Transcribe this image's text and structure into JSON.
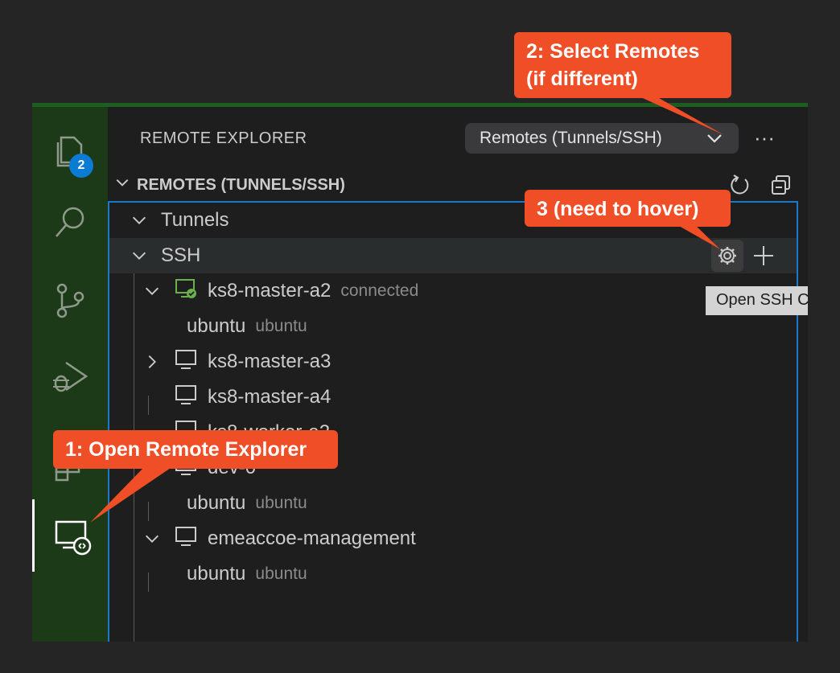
{
  "activity_bar": {
    "explorer_badge": "2"
  },
  "panel": {
    "title": "REMOTE EXPLORER",
    "dropdown_label": "Remotes (Tunnels/SSH)",
    "more_label": "···",
    "section_title": "REMOTES (TUNNELS/SSH)"
  },
  "tree": {
    "tunnels_label": "Tunnels",
    "ssh_label": "SSH",
    "hosts": [
      {
        "name": "ks8-master-a2",
        "status": "connected"
      },
      {
        "child_name": "ubuntu",
        "child_desc": "ubuntu"
      },
      {
        "name": "ks8-master-a3"
      },
      {
        "name": "ks8-master-a4"
      },
      {
        "name": "ks8-worker-a2"
      },
      {
        "name": "dev-0"
      },
      {
        "child_name": "ubuntu",
        "child_desc": "ubuntu"
      },
      {
        "name": "emeaccoe-management"
      },
      {
        "child_name": "ubuntu",
        "child_desc": "ubuntu"
      }
    ]
  },
  "tooltip": "Open SSH Config File",
  "callouts": {
    "one": "1: Open Remote Explorer",
    "two_line1": "2: Select Remotes",
    "two_line2": "(if different)",
    "three": "3 (need to hover)"
  },
  "colors": {
    "callout": "#f04e26",
    "accent": "#1a7ac9",
    "activity_bg": "#1c3a17",
    "badge": "#0b7bd3"
  }
}
